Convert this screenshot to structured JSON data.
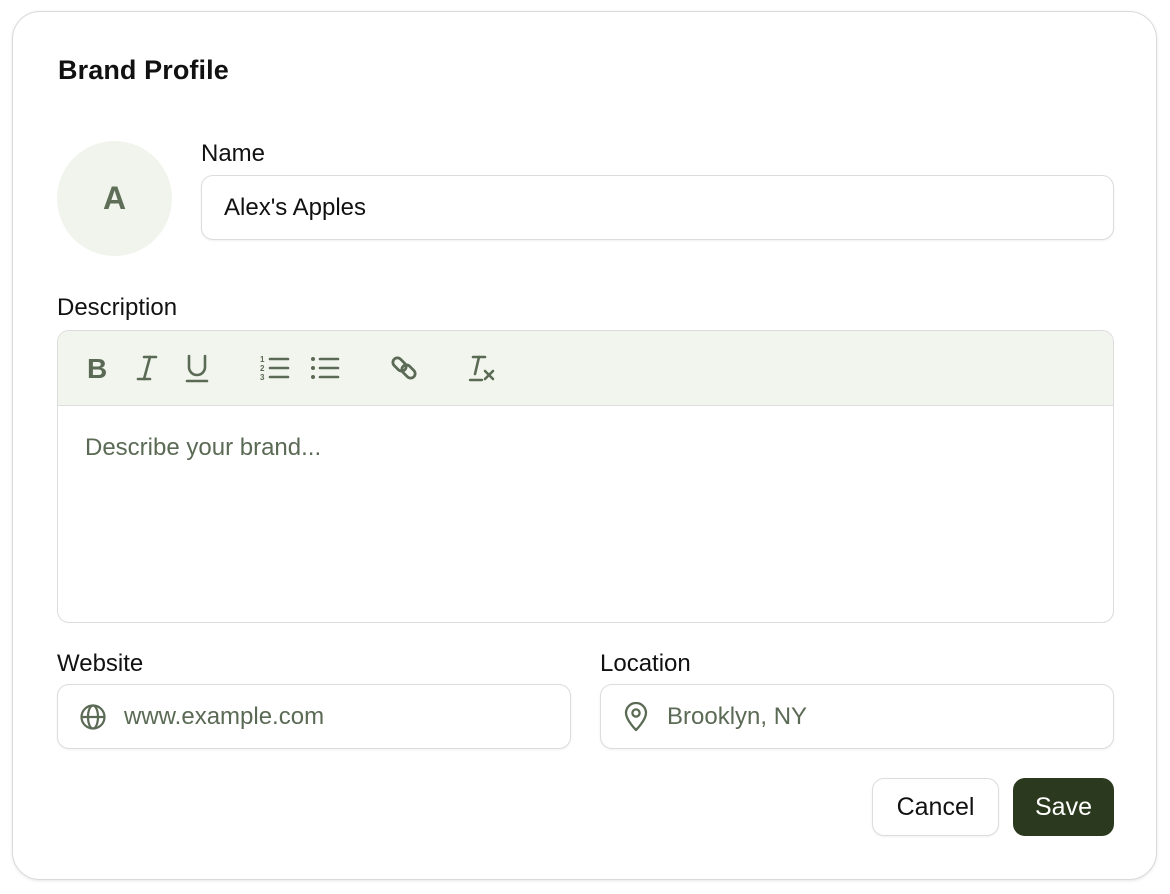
{
  "card": {
    "title": "Brand Profile"
  },
  "avatar": {
    "initial": "A"
  },
  "name_field": {
    "label": "Name",
    "value": "Alex's Apples"
  },
  "description": {
    "label": "Description",
    "placeholder": "Describe your brand...",
    "toolbar": [
      {
        "name": "bold-icon",
        "glyph": "B"
      },
      {
        "name": "italic-icon",
        "glyph": "I"
      },
      {
        "name": "underline-icon",
        "glyph": "U"
      },
      {
        "name": "ordered-list-icon"
      },
      {
        "name": "bullet-list-icon"
      },
      {
        "name": "link-icon"
      },
      {
        "name": "clear-format-icon"
      }
    ]
  },
  "website_field": {
    "label": "Website",
    "placeholder": "www.example.com",
    "icon": "globe-icon"
  },
  "location_field": {
    "label": "Location",
    "placeholder": "Brooklyn, NY",
    "icon": "map-pin-icon"
  },
  "actions": {
    "cancel_label": "Cancel",
    "save_label": "Save"
  },
  "colors": {
    "accent": "#2b3a1e",
    "muted_text": "#5b6a54",
    "toolbar_bg": "#f2f5ee",
    "avatar_bg": "#f1f4ec"
  }
}
